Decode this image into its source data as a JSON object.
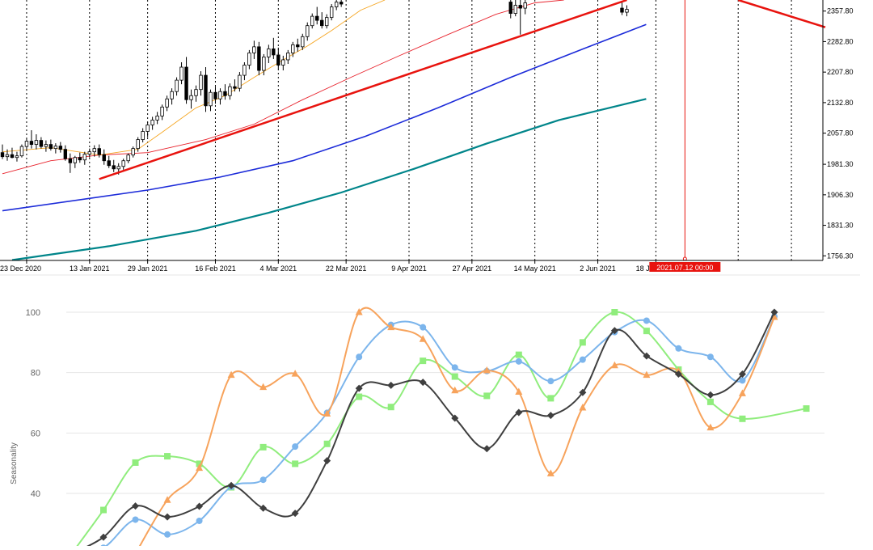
{
  "chart_data": [
    {
      "type": "candlestick",
      "x_labels": [
        "23 Dec 2020",
        "13 Jan 2021",
        "29 Jan 2021",
        "16 Feb 2021",
        "4 Mar 2021",
        "22 Mar 2021",
        "9 Apr 2021",
        "27 Apr 2021",
        "14 May 2021",
        "2 Jun 2021",
        "18 Jun 2021"
      ],
      "y_ticks": [
        "2357.80",
        "2282.80",
        "2207.80",
        "2132.80",
        "2057.80",
        "1981.30",
        "1906.30",
        "1831.30",
        "1756.30"
      ],
      "ylim": [
        1745,
        2385
      ],
      "crosshair_label": "2021.07.12 00:00",
      "colors": {
        "candle": "#000000",
        "ma_fast": "#f5a623",
        "ma_mid": "#e8222c",
        "ma_slow": "#1c2bd9",
        "ma_long": "#00858a",
        "trendline": "#e8130e",
        "marker": "#e8130e"
      },
      "candles": [
        {
          "i": 0,
          "o": 2010,
          "h": 2030,
          "l": 1994,
          "c": 2000
        },
        {
          "i": 1,
          "o": 2000,
          "h": 2018,
          "l": 1990,
          "c": 2005
        },
        {
          "i": 2,
          "o": 2005,
          "h": 2022,
          "l": 1996,
          "c": 1998
        },
        {
          "i": 3,
          "o": 1998,
          "h": 2012,
          "l": 1988,
          "c": 2002
        },
        {
          "i": 4,
          "o": 2002,
          "h": 2030,
          "l": 1998,
          "c": 2025
        },
        {
          "i": 5,
          "o": 2025,
          "h": 2045,
          "l": 2015,
          "c": 2038
        },
        {
          "i": 6,
          "o": 2038,
          "h": 2065,
          "l": 2020,
          "c": 2030
        },
        {
          "i": 7,
          "o": 2030,
          "h": 2055,
          "l": 2018,
          "c": 2040
        },
        {
          "i": 8,
          "o": 2040,
          "h": 2048,
          "l": 2020,
          "c": 2025
        },
        {
          "i": 9,
          "o": 2025,
          "h": 2040,
          "l": 2012,
          "c": 2030
        },
        {
          "i": 10,
          "o": 2030,
          "h": 2042,
          "l": 2015,
          "c": 2020
        },
        {
          "i": 11,
          "o": 2020,
          "h": 2033,
          "l": 2008,
          "c": 2026
        },
        {
          "i": 12,
          "o": 2026,
          "h": 2036,
          "l": 2010,
          "c": 2018
        },
        {
          "i": 13,
          "o": 2018,
          "h": 2028,
          "l": 1990,
          "c": 1995
        },
        {
          "i": 14,
          "o": 1995,
          "h": 2008,
          "l": 1960,
          "c": 1985
        },
        {
          "i": 15,
          "o": 1985,
          "h": 2002,
          "l": 1972,
          "c": 1998
        },
        {
          "i": 16,
          "o": 1998,
          "h": 2010,
          "l": 1985,
          "c": 1992
        },
        {
          "i": 17,
          "o": 1992,
          "h": 2012,
          "l": 1980,
          "c": 2006
        },
        {
          "i": 18,
          "o": 2006,
          "h": 2020,
          "l": 1998,
          "c": 2012
        },
        {
          "i": 19,
          "o": 2012,
          "h": 2028,
          "l": 2000,
          "c": 2020
        },
        {
          "i": 20,
          "o": 2020,
          "h": 2030,
          "l": 1998,
          "c": 2005
        },
        {
          "i": 21,
          "o": 2005,
          "h": 2018,
          "l": 1980,
          "c": 1990
        },
        {
          "i": 22,
          "o": 1990,
          "h": 2002,
          "l": 1972,
          "c": 1978
        },
        {
          "i": 23,
          "o": 1978,
          "h": 1992,
          "l": 1962,
          "c": 1970
        },
        {
          "i": 24,
          "o": 1970,
          "h": 1984,
          "l": 1956,
          "c": 1976
        },
        {
          "i": 25,
          "o": 1976,
          "h": 1995,
          "l": 1968,
          "c": 1990
        },
        {
          "i": 26,
          "o": 1990,
          "h": 2008,
          "l": 1984,
          "c": 2004
        },
        {
          "i": 27,
          "o": 2004,
          "h": 2025,
          "l": 1998,
          "c": 2020
        },
        {
          "i": 28,
          "o": 2020,
          "h": 2048,
          "l": 2012,
          "c": 2042
        },
        {
          "i": 29,
          "o": 2042,
          "h": 2070,
          "l": 2035,
          "c": 2062
        },
        {
          "i": 30,
          "o": 2062,
          "h": 2085,
          "l": 2048,
          "c": 2078
        },
        {
          "i": 31,
          "o": 2078,
          "h": 2098,
          "l": 2066,
          "c": 2090
        },
        {
          "i": 32,
          "o": 2090,
          "h": 2110,
          "l": 2080,
          "c": 2100
        },
        {
          "i": 33,
          "o": 2100,
          "h": 2128,
          "l": 2090,
          "c": 2122
        },
        {
          "i": 34,
          "o": 2122,
          "h": 2150,
          "l": 2112,
          "c": 2142
        },
        {
          "i": 35,
          "o": 2142,
          "h": 2168,
          "l": 2128,
          "c": 2160
        },
        {
          "i": 36,
          "o": 2160,
          "h": 2195,
          "l": 2150,
          "c": 2188
        },
        {
          "i": 37,
          "o": 2188,
          "h": 2232,
          "l": 2178,
          "c": 2220
        },
        {
          "i": 38,
          "o": 2220,
          "h": 2245,
          "l": 2130,
          "c": 2140
        },
        {
          "i": 39,
          "o": 2140,
          "h": 2165,
          "l": 2118,
          "c": 2150
        },
        {
          "i": 40,
          "o": 2150,
          "h": 2175,
          "l": 2135,
          "c": 2165
        },
        {
          "i": 41,
          "o": 2165,
          "h": 2210,
          "l": 2150,
          "c": 2200
        },
        {
          "i": 42,
          "o": 2200,
          "h": 2220,
          "l": 2110,
          "c": 2125
        },
        {
          "i": 43,
          "o": 2125,
          "h": 2165,
          "l": 2112,
          "c": 2158
        },
        {
          "i": 44,
          "o": 2158,
          "h": 2172,
          "l": 2130,
          "c": 2142
        },
        {
          "i": 45,
          "o": 2142,
          "h": 2168,
          "l": 2128,
          "c": 2160
        },
        {
          "i": 46,
          "o": 2160,
          "h": 2178,
          "l": 2140,
          "c": 2150
        },
        {
          "i": 47,
          "o": 2150,
          "h": 2180,
          "l": 2140,
          "c": 2172
        },
        {
          "i": 48,
          "o": 2172,
          "h": 2190,
          "l": 2160,
          "c": 2168
        },
        {
          "i": 49,
          "o": 2168,
          "h": 2208,
          "l": 2160,
          "c": 2200
        },
        {
          "i": 50,
          "o": 2200,
          "h": 2232,
          "l": 2188,
          "c": 2225
        },
        {
          "i": 51,
          "o": 2225,
          "h": 2262,
          "l": 2215,
          "c": 2255
        },
        {
          "i": 52,
          "o": 2255,
          "h": 2285,
          "l": 2240,
          "c": 2270
        },
        {
          "i": 53,
          "o": 2270,
          "h": 2282,
          "l": 2200,
          "c": 2212
        },
        {
          "i": 54,
          "o": 2212,
          "h": 2252,
          "l": 2200,
          "c": 2245
        },
        {
          "i": 55,
          "o": 2245,
          "h": 2275,
          "l": 2230,
          "c": 2265
        },
        {
          "i": 56,
          "o": 2265,
          "h": 2292,
          "l": 2240,
          "c": 2250
        },
        {
          "i": 57,
          "o": 2250,
          "h": 2268,
          "l": 2215,
          "c": 2225
        },
        {
          "i": 58,
          "o": 2225,
          "h": 2248,
          "l": 2212,
          "c": 2238
        },
        {
          "i": 59,
          "o": 2238,
          "h": 2262,
          "l": 2228,
          "c": 2255
        },
        {
          "i": 60,
          "o": 2255,
          "h": 2282,
          "l": 2245,
          "c": 2275
        },
        {
          "i": 61,
          "o": 2275,
          "h": 2290,
          "l": 2258,
          "c": 2270
        },
        {
          "i": 62,
          "o": 2270,
          "h": 2302,
          "l": 2262,
          "c": 2295
        },
        {
          "i": 63,
          "o": 2295,
          "h": 2330,
          "l": 2285,
          "c": 2322
        },
        {
          "i": 64,
          "o": 2322,
          "h": 2352,
          "l": 2315,
          "c": 2345
        },
        {
          "i": 65,
          "o": 2345,
          "h": 2368,
          "l": 2325,
          "c": 2335
        },
        {
          "i": 66,
          "o": 2335,
          "h": 2355,
          "l": 2315,
          "c": 2322
        },
        {
          "i": 67,
          "o": 2322,
          "h": 2350,
          "l": 2315,
          "c": 2342
        },
        {
          "i": 68,
          "o": 2342,
          "h": 2375,
          "l": 2335,
          "c": 2368
        },
        {
          "i": 69,
          "o": 2368,
          "h": 2385,
          "l": 2360,
          "c": 2380
        },
        {
          "i": 70,
          "o": 2380,
          "h": 2385,
          "l": 2368,
          "c": 2375
        },
        {
          "i": 105,
          "o": 2380,
          "h": 2385,
          "l": 2340,
          "c": 2352
        },
        {
          "i": 106,
          "o": 2352,
          "h": 2385,
          "l": 2345,
          "c": 2372
        },
        {
          "i": 107,
          "o": 2372,
          "h": 2385,
          "l": 2300,
          "c": 2365
        },
        {
          "i": 108,
          "o": 2365,
          "h": 2385,
          "l": 2350,
          "c": 2378
        },
        {
          "i": 128,
          "o": 2365,
          "h": 2380,
          "l": 2348,
          "c": 2355
        },
        {
          "i": 129,
          "o": 2355,
          "h": 2372,
          "l": 2345,
          "c": 2362
        }
      ],
      "ma_fast": [
        [
          0,
          2012
        ],
        [
          10,
          2022
        ],
        [
          20,
          2004
        ],
        [
          28,
          2018
        ],
        [
          33,
          2060
        ],
        [
          40,
          2120
        ],
        [
          46,
          2150
        ],
        [
          52,
          2195
        ],
        [
          58,
          2238
        ],
        [
          63,
          2272
        ],
        [
          68,
          2310
        ],
        [
          74,
          2360
        ],
        [
          79,
          2385
        ]
      ],
      "ma_mid": [
        [
          0,
          1958
        ],
        [
          10,
          1990
        ],
        [
          20,
          2004
        ],
        [
          30,
          2010
        ],
        [
          42,
          2042
        ],
        [
          52,
          2080
        ],
        [
          62,
          2140
        ],
        [
          72,
          2195
        ],
        [
          82,
          2248
        ],
        [
          92,
          2300
        ],
        [
          102,
          2350
        ],
        [
          110,
          2378
        ],
        [
          116,
          2385
        ]
      ],
      "ma_slow": [
        [
          0,
          1867
        ],
        [
          30,
          1918
        ],
        [
          45,
          1950
        ],
        [
          60,
          1990
        ],
        [
          75,
          2050
        ],
        [
          90,
          2120
        ],
        [
          105,
          2195
        ],
        [
          120,
          2265
        ],
        [
          133,
          2325
        ]
      ],
      "ma_long": [
        [
          2,
          1746
        ],
        [
          22,
          1780
        ],
        [
          40,
          1818
        ],
        [
          55,
          1862
        ],
        [
          70,
          1912
        ],
        [
          85,
          1970
        ],
        [
          100,
          2032
        ],
        [
          115,
          2090
        ],
        [
          133,
          2142
        ]
      ],
      "trendlines": [
        {
          "from": [
            20,
            1945
          ],
          "to": [
            129,
            2385
          ]
        },
        {
          "from": [
            152,
            2385
          ],
          "to": [
            170,
            2318
          ]
        }
      ],
      "vertical_marker_index": 141,
      "n_slots": 170
    },
    {
      "type": "line",
      "ylabel": "Seasonality",
      "y_ticks": [
        40,
        60,
        80,
        100
      ],
      "ylim": [
        20,
        105
      ],
      "x": [
        1,
        2,
        3,
        4,
        5,
        6,
        7,
        8,
        9,
        10,
        11,
        12,
        13,
        14,
        15,
        16,
        17,
        18,
        19,
        20,
        21,
        22,
        23,
        24
      ],
      "series": [
        {
          "marker": "diamond",
          "color": "#3f3f3f",
          "values": [
            20,
            25.5,
            35.8,
            32.2,
            35.7,
            42.6,
            35.1,
            33.4,
            50.8,
            74.8,
            75.8,
            76.8,
            64.9,
            54.8,
            66.8,
            65.8,
            73.4,
            93.9,
            85.5,
            79.5,
            72.6,
            79.5,
            100,
            null
          ]
        },
        {
          "marker": "circle",
          "color": "#7cb5ec",
          "values": [
            20,
            22,
            31.3,
            26.4,
            30.9,
            42.2,
            44.5,
            55.5,
            66.7,
            85.2,
            95.8,
            95,
            81.7,
            80.5,
            83.7,
            77.2,
            84.3,
            93.4,
            97.2,
            88,
            85.2,
            77.4,
            98.6,
            null
          ]
        },
        {
          "marker": "square",
          "color": "#90ed7d",
          "values": [
            20,
            34.5,
            50.2,
            52.3,
            49.8,
            42,
            55.3,
            49.8,
            56.4,
            72,
            68.6,
            83.9,
            78.7,
            72.3,
            85.9,
            71.5,
            90,
            100,
            93.8,
            81,
            70.3,
            64.7,
            null,
            68.1
          ]
        },
        {
          "marker": "triangle",
          "color": "#f7a35c",
          "values": [
            null,
            null,
            20,
            37.8,
            48.4,
            79.2,
            75.2,
            79.6,
            66.4,
            100,
            95,
            91.1,
            74.1,
            80.7,
            73.6,
            46.6,
            68.4,
            82.4,
            79.2,
            80.5,
            61.8,
            73.1,
            98.4,
            null
          ]
        }
      ]
    }
  ]
}
